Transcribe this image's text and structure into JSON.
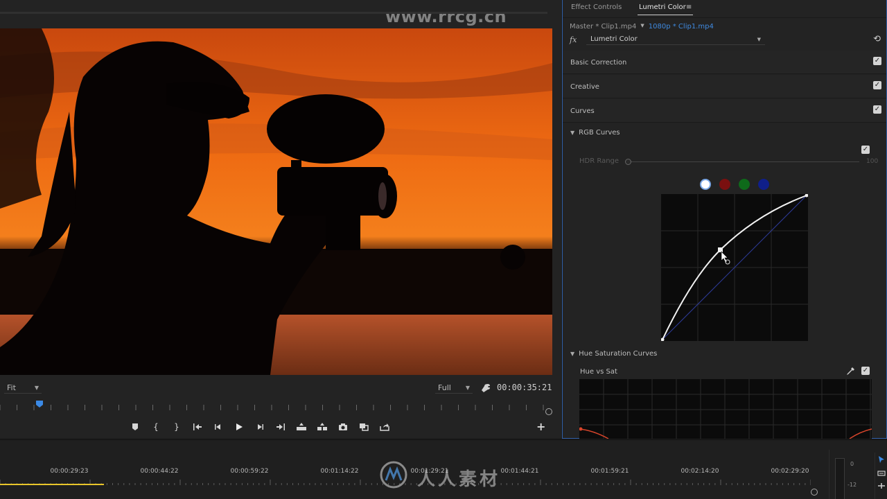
{
  "monitor": {
    "watermark_url": "www.rrcg.cn",
    "zoom_select": "Fit",
    "quality_select": "Full",
    "timecode": "00:00:35:21",
    "transport_buttons": [
      "add-marker",
      "mark-in",
      "mark-out",
      "go-to-in",
      "step-back",
      "play",
      "step-forward",
      "go-to-out",
      "lift",
      "extract",
      "export-frame",
      "comparison-view",
      "insert-overwrite"
    ],
    "icons": {
      "mark_in": "{",
      "mark_out": "}",
      "add_button": "+"
    }
  },
  "panel": {
    "tabs": [
      "Effect Controls",
      "Lumetri Color"
    ],
    "active_tab": "Lumetri Color",
    "menu_icon": "≡",
    "clip_source": "Master * Clip1.mp4",
    "clip_sequence": "1080p * Clip1.mp4",
    "fx_label": "fx",
    "effect": "Lumetri Color",
    "sections": [
      {
        "label": "Basic Correction",
        "checked": true
      },
      {
        "label": "Creative",
        "checked": true
      },
      {
        "label": "Curves",
        "checked": true
      }
    ],
    "rgb_curves": {
      "label": "RGB Curves",
      "enabled": true,
      "hdr_range_label": "HDR Range",
      "hdr_range_value": "100",
      "channels": [
        "white",
        "red",
        "green",
        "blue"
      ],
      "selected_channel": "white"
    },
    "hue_sat": {
      "label": "Hue Saturation Curves",
      "sub_label": "Hue vs Sat",
      "enabled": true
    }
  },
  "timeline": {
    "timecodes": [
      "00:00:29:23",
      "00:00:44:22",
      "00:00:59:22",
      "00:01:14:22",
      "00:01:29:21",
      "00:01:44:21",
      "00:01:59:21",
      "00:02:14:20",
      "00:02:29:20"
    ],
    "meter_labels": [
      "0",
      "-12"
    ],
    "logo_text": "人人素材"
  },
  "colors": {
    "accent_blue": "#3b8ae6",
    "playhead_yellow": "#e8c52a",
    "panel_border": "#2f5fa8"
  }
}
